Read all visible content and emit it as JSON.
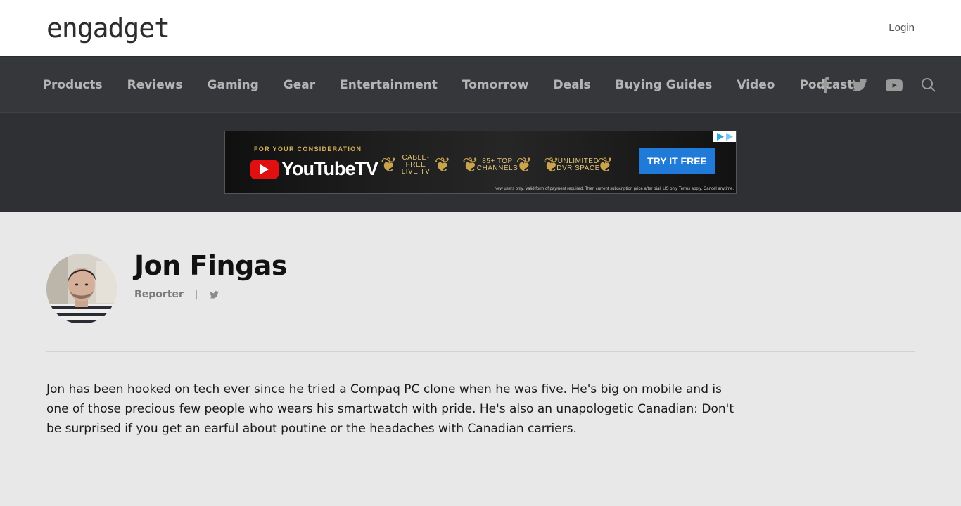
{
  "header": {
    "logo_text": "engadget",
    "login_label": "Login"
  },
  "nav": {
    "items": [
      {
        "label": "Products"
      },
      {
        "label": "Reviews"
      },
      {
        "label": "Gaming"
      },
      {
        "label": "Gear"
      },
      {
        "label": "Entertainment"
      },
      {
        "label": "Tomorrow"
      },
      {
        "label": "Deals"
      },
      {
        "label": "Buying Guides"
      },
      {
        "label": "Video"
      },
      {
        "label": "Podcasts"
      }
    ],
    "icons": [
      "facebook-icon",
      "twitter-icon",
      "youtube-icon",
      "search-icon"
    ]
  },
  "ad": {
    "kicker": "FOR YOUR CONSIDERATION",
    "brand": "YouTubeTV",
    "badges": [
      {
        "line1": "CABLE-FREE",
        "line2": "LIVE TV"
      },
      {
        "line1": "85+ TOP",
        "line2": "CHANNELS"
      },
      {
        "line1": "UNLIMITED",
        "line2": "DVR SPACE"
      }
    ],
    "cta": "TRY IT FREE",
    "fine_print": "New users only. Valid form of payment required. Then current subscription price after trial. US only Terms apply. Cancel anytime."
  },
  "author": {
    "name": "Jon Fingas",
    "role": "Reporter",
    "separator": "|",
    "bio": "Jon has been hooked on tech ever since he tried a Compaq PC clone when he was five. He's big on mobile and is one of those precious few people who wears his smartwatch with pride. He's also an unapologetic Canadian: Don't be surprised if you get an earful about poutine or the headaches with Canadian carriers."
  },
  "colors": {
    "nav_bg": "#35373b",
    "ad_band_bg": "#2e3034",
    "page_bg": "#e8e8e8",
    "cta_blue": "#1f7ad8",
    "yt_red": "#e01010"
  }
}
